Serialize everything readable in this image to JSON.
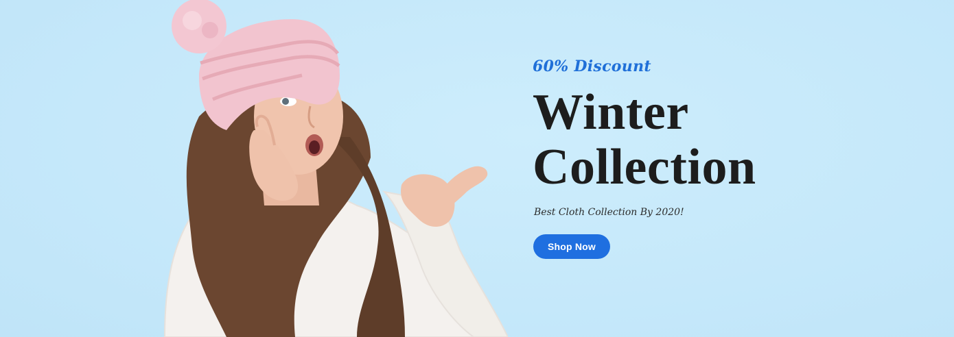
{
  "hero": {
    "kicker": "60% Discount",
    "title_line1": "Winter",
    "title_line2": "Collection",
    "subtitle": "Best Cloth Collection By 2020!",
    "cta_label": "Shop Now"
  },
  "colors": {
    "background": "#c8eafb",
    "accent": "#1f6fe0",
    "heading": "#1d1d1d",
    "kicker": "#1f6fd8"
  }
}
